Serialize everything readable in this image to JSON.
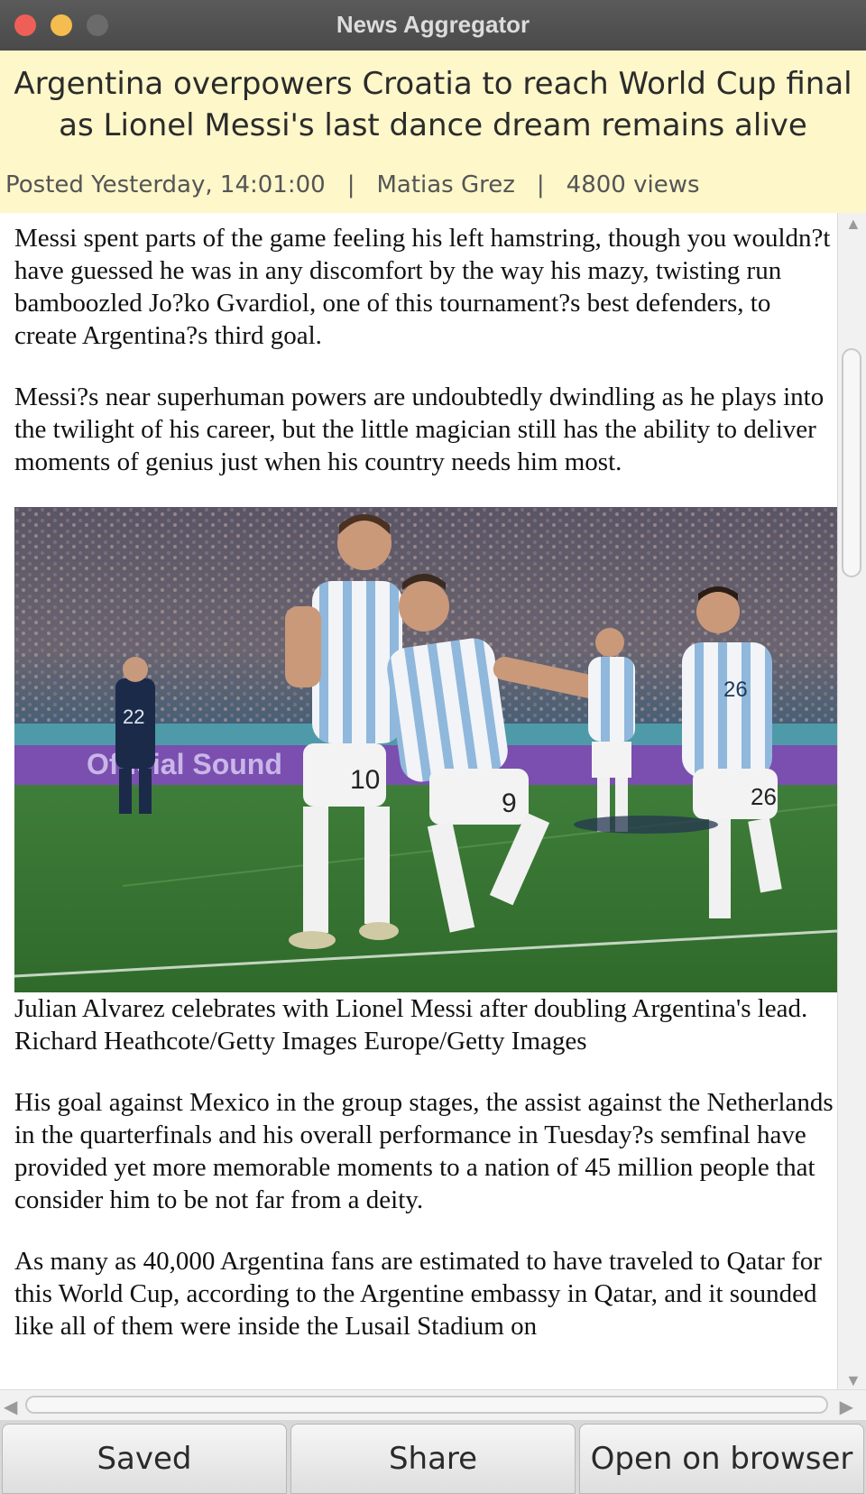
{
  "window": {
    "title": "News Aggregator"
  },
  "article": {
    "headline": "Argentina overpowers Croatia to reach World Cup final as Lionel Messi's last dance dream remains alive",
    "meta": {
      "posted": "Posted Yesterday, 14:01:00",
      "author": "Matias Grez",
      "views": "4800 views",
      "separator": "|"
    },
    "paragraphs": [
      "Messi spent parts of the game feeling his left hamstring, though you wouldn?t have guessed he was in any discomfort by the way his mazy, twisting run bamboozled Jo?ko Gvardiol, one of this tournament?s best defenders, to create Argentina?s third goal.",
      "Messi?s near superhuman powers are undoubtedly dwindling as he plays into the twilight of his career, but the little magician still has the ability to deliver moments of genius just when his country needs him most."
    ],
    "image": {
      "caption": "Julian Alvarez celebrates with Lionel Messi after doubling Argentina's lead.",
      "credit": "Richard Heathcote/Getty Images Europe/Getty Images",
      "shirt_numbers": [
        "10",
        "9",
        "26",
        "22"
      ],
      "banner_text": "Official Sound"
    },
    "paragraphs_after": [
      "His goal against Mexico in the group stages, the assist against the Netherlands in the quarterfinals and his overall performance in Tuesday?s semfinal have provided yet more memorable moments to a nation of 45 million people that consider him to be not far from a deity.",
      "As many as 40,000 Argentina fans are estimated to have traveled to Qatar for this World Cup, according to the Argentine embassy in Qatar, and it sounded like all of them were inside the Lusail Stadium on"
    ]
  },
  "buttons": {
    "saved": "Saved",
    "share": "Share",
    "open": "Open on browser"
  },
  "colors": {
    "header_bg": "#fdf7c9",
    "titlebar_bg": "#4f4f4f",
    "close": "#ee5f57",
    "minimize": "#f5bd4f"
  },
  "icons": {
    "scroll_up": "▲",
    "scroll_down": "▼",
    "scroll_left": "◀",
    "scroll_right": "▶"
  }
}
